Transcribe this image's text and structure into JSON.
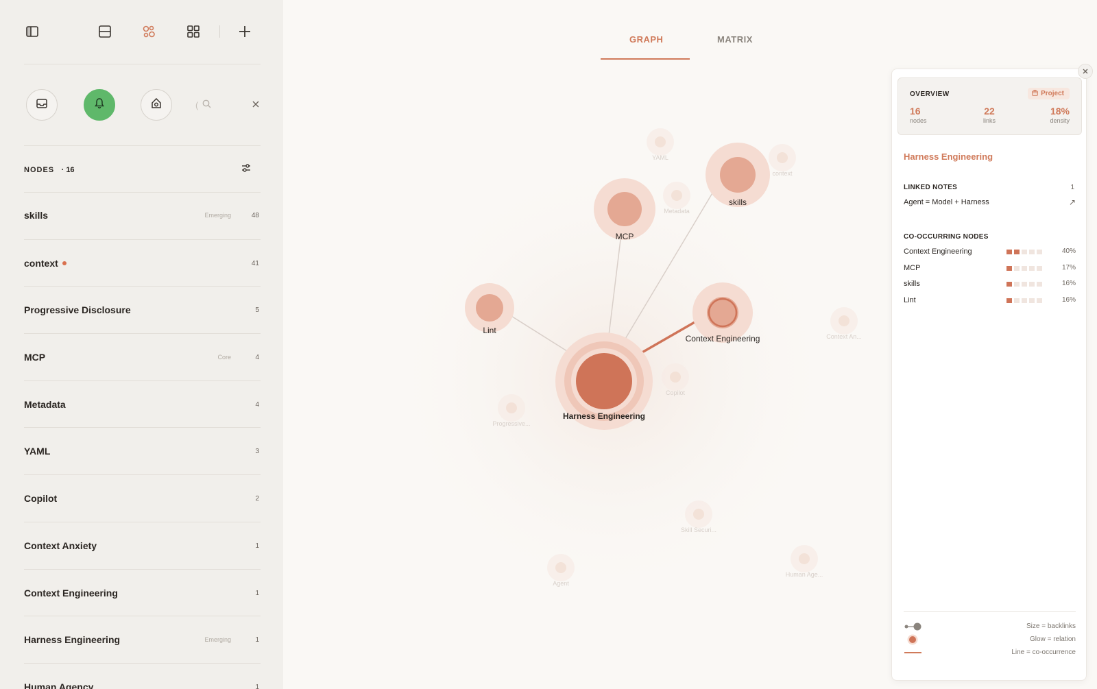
{
  "toolbar": {
    "icons": [
      "sidebar-toggle-icon",
      "layout-split-icon",
      "graph-view-icon",
      "grid-view-icon",
      "plus-icon"
    ]
  },
  "search": {
    "placeholder": ""
  },
  "nodes_header": {
    "title": "NODES",
    "count": "16"
  },
  "nodes": [
    {
      "name": "skills",
      "tag": "Emerging",
      "count": "48",
      "dot": false
    },
    {
      "name": "context",
      "tag": "",
      "count": "41",
      "dot": true
    },
    {
      "name": "Progressive Disclosure",
      "tag": "",
      "count": "5",
      "dot": false
    },
    {
      "name": "MCP",
      "tag": "Core",
      "count": "4",
      "dot": false
    },
    {
      "name": "Metadata",
      "tag": "",
      "count": "4",
      "dot": false
    },
    {
      "name": "YAML",
      "tag": "",
      "count": "3",
      "dot": false
    },
    {
      "name": "Copilot",
      "tag": "",
      "count": "2",
      "dot": false
    },
    {
      "name": "Context Anxiety",
      "tag": "",
      "count": "1",
      "dot": false
    },
    {
      "name": "Context Engineering",
      "tag": "",
      "count": "1",
      "dot": false
    },
    {
      "name": "Harness Engineering",
      "tag": "Emerging",
      "count": "1",
      "dot": false
    },
    {
      "name": "Human Agency",
      "tag": "",
      "count": "1",
      "dot": false
    }
  ],
  "tabs": {
    "graph": "GRAPH",
    "matrix": "MATRIX",
    "active": "graph"
  },
  "graph": {
    "focus_node": "Harness Engineering",
    "visible_nodes": [
      "Harness Engineering",
      "MCP",
      "skills",
      "Lint",
      "Context Engineering"
    ],
    "faded_nodes": [
      "YAML",
      "Metadata",
      "context",
      "Context An...",
      "Progressive...",
      "Copilot",
      "Skill Securi...",
      "Human Age...",
      "Agent"
    ]
  },
  "overview": {
    "title": "OVERVIEW",
    "badge": "Project",
    "nodes_value": "16",
    "nodes_label": "nodes",
    "links_value": "22",
    "links_label": "links",
    "density_value": "18%",
    "density_label": "density"
  },
  "selected": {
    "title": "Harness Engineering",
    "linked_notes_label": "LINKED NOTES",
    "linked_notes_count": "1",
    "linked_note": "Agent = Model + Harness",
    "co_label": "CO-OCCURRING NODES",
    "co_nodes": [
      {
        "name": "Context Engineering",
        "pct": "40%",
        "level": 0.4
      },
      {
        "name": "MCP",
        "pct": "17%",
        "level": 0.17
      },
      {
        "name": "skills",
        "pct": "16%",
        "level": 0.16
      },
      {
        "name": "Lint",
        "pct": "16%",
        "level": 0.16
      }
    ]
  },
  "legend": {
    "size": "Size = backlinks",
    "glow": "Glow = relation",
    "line": "Line = co-occurrence"
  },
  "colors": {
    "accent": "#d07a5a",
    "active_bell": "#5fb86a",
    "node_fill": "#e2a896",
    "node_halo": "#f3dbd1"
  }
}
